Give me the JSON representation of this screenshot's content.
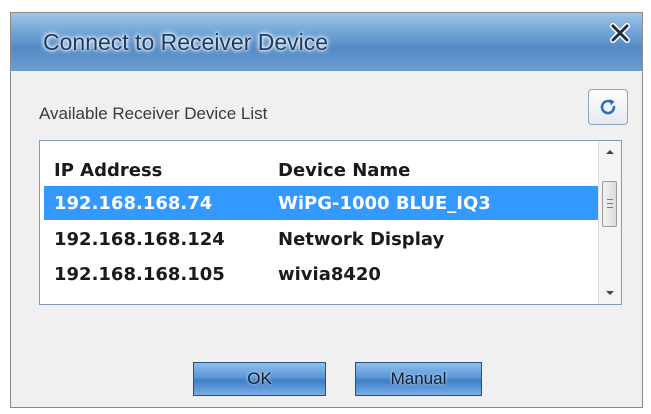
{
  "dialog": {
    "title": "Connect to Receiver Device",
    "close_icon": "close-icon"
  },
  "list_section": {
    "label": "Available Receiver Device List",
    "refresh_icon": "refresh-icon"
  },
  "table": {
    "columns": [
      "IP Address",
      "Device Name"
    ],
    "rows": [
      {
        "ip": "192.168.168.74",
        "name": "WiPG-1000 BLUE_IQ3",
        "selected": true
      },
      {
        "ip": "192.168.168.124",
        "name": "Network Display",
        "selected": false
      },
      {
        "ip": "192.168.168.105",
        "name": "wivia8420",
        "selected": false
      }
    ],
    "selected_color": "#3399ff"
  },
  "buttons": {
    "ok_label": "OK",
    "manual_label": "Manual"
  }
}
